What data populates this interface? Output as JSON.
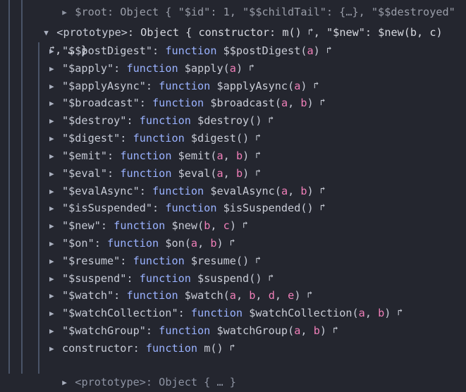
{
  "top_line": {
    "prefix": "$root",
    "rest": ": Object { \"$id\": 1, \"$$childTail\": {…}, \"$$destroyed\""
  },
  "proto_header": {
    "label": "<prototype>",
    "summary_a": ": Object { constructor: m() ",
    "summary_b": ", \"$new\": $new(b, c)",
    "summary_c": ", … }"
  },
  "methods": [
    {
      "key": "\"$$postDigest\"",
      "name": "$$postDigest",
      "args": [
        "a"
      ]
    },
    {
      "key": "\"$apply\"",
      "name": "$apply",
      "args": [
        "a"
      ]
    },
    {
      "key": "\"$applyAsync\"",
      "name": "$applyAsync",
      "args": [
        "a"
      ]
    },
    {
      "key": "\"$broadcast\"",
      "name": "$broadcast",
      "args": [
        "a",
        "b"
      ]
    },
    {
      "key": "\"$destroy\"",
      "name": "$destroy",
      "args": []
    },
    {
      "key": "\"$digest\"",
      "name": "$digest",
      "args": []
    },
    {
      "key": "\"$emit\"",
      "name": "$emit",
      "args": [
        "a",
        "b"
      ]
    },
    {
      "key": "\"$eval\"",
      "name": "$eval",
      "args": [
        "a",
        "b"
      ]
    },
    {
      "key": "\"$evalAsync\"",
      "name": "$evalAsync",
      "args": [
        "a",
        "b"
      ]
    },
    {
      "key": "\"$isSuspended\"",
      "name": "$isSuspended",
      "args": []
    },
    {
      "key": "\"$new\"",
      "name": "$new",
      "args": [
        "b",
        "c"
      ]
    },
    {
      "key": "\"$on\"",
      "name": "$on",
      "args": [
        "a",
        "b"
      ]
    },
    {
      "key": "\"$resume\"",
      "name": "$resume",
      "args": []
    },
    {
      "key": "\"$suspend\"",
      "name": "$suspend",
      "args": []
    },
    {
      "key": "\"$watch\"",
      "name": "$watch",
      "args": [
        "a",
        "b",
        "d",
        "e"
      ]
    },
    {
      "key": "\"$watchCollection\"",
      "name": "$watchCollection",
      "args": [
        "a",
        "b"
      ]
    },
    {
      "key": "\"$watchGroup\"",
      "name": "$watchGroup",
      "args": [
        "a",
        "b"
      ]
    },
    {
      "key": "constructor",
      "name": "m",
      "args": []
    }
  ],
  "keyword_function": "function",
  "last_proto": {
    "label": "<prototype>",
    "value": ": Object { … }"
  },
  "colors": {
    "background": "#24262f",
    "function_keyword": "#9ab2ff",
    "argument": "#f07fb9"
  },
  "icons": {
    "expand": "triangle-right-icon",
    "collapse": "triangle-down-icon",
    "jump": "jump-to-definition-icon"
  }
}
